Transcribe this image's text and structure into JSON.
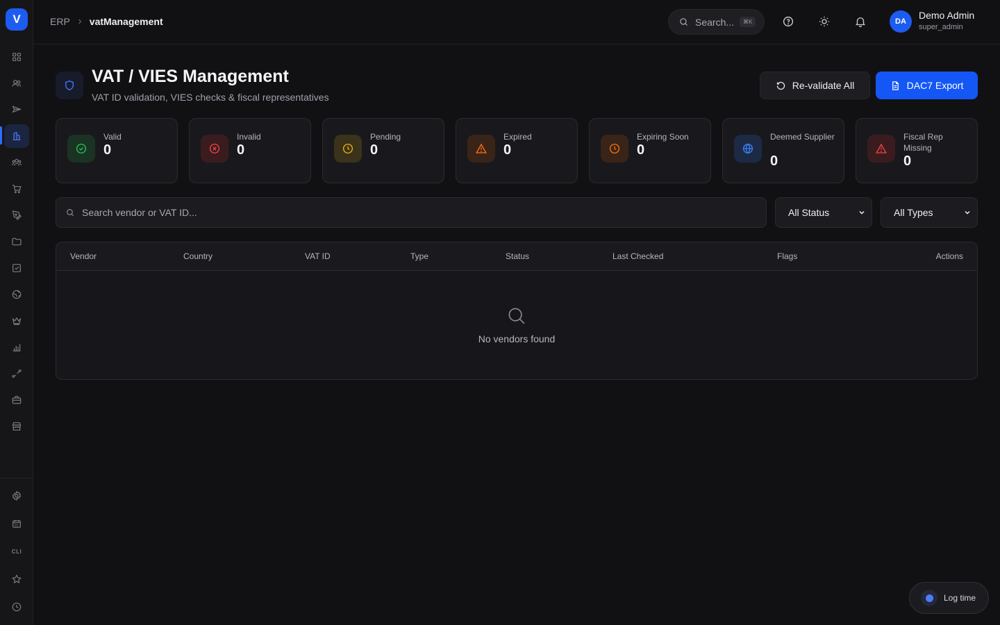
{
  "sidebar": {
    "logo": "V",
    "cli_label": "CLI",
    "items": [
      {
        "icon": "dashboard-grid-icon",
        "active": false
      },
      {
        "icon": "users-icon",
        "active": false
      },
      {
        "icon": "send-icon",
        "active": false
      },
      {
        "icon": "building-icon",
        "active": true
      },
      {
        "icon": "team-icon",
        "active": false
      },
      {
        "icon": "cart-icon",
        "active": false
      },
      {
        "icon": "pen-tool-icon",
        "active": false
      },
      {
        "icon": "folder-icon",
        "active": false
      },
      {
        "icon": "checkbox-icon",
        "active": false
      },
      {
        "icon": "globe-icon",
        "active": false
      },
      {
        "icon": "crown-icon",
        "active": false
      },
      {
        "icon": "bar-chart-icon",
        "active": false
      },
      {
        "icon": "route-icon",
        "active": false
      },
      {
        "icon": "briefcase-icon",
        "active": false
      },
      {
        "icon": "store-icon",
        "active": false
      }
    ],
    "bottom_items": [
      {
        "icon": "settings-gear-icon"
      },
      {
        "icon": "calendar-icon"
      },
      {
        "icon": "cli-icon"
      },
      {
        "icon": "star-icon"
      },
      {
        "icon": "clock-icon"
      }
    ]
  },
  "topbar": {
    "breadcrumb": {
      "root": "ERP",
      "current": "vatManagement"
    },
    "search": {
      "placeholder": "Search...",
      "shortcut": "⌘K"
    },
    "user": {
      "initials": "DA",
      "name": "Demo Admin",
      "role": "super_admin"
    }
  },
  "header": {
    "title": "VAT / VIES Management",
    "subtitle": "VAT ID validation, VIES checks & fiscal representatives",
    "revalidate_label": "Re-validate All",
    "export_label": "DAC7 Export"
  },
  "stats": [
    {
      "label": "Valid",
      "value": "0",
      "color": "#22c55e",
      "icon": "check-circle-icon"
    },
    {
      "label": "Invalid",
      "value": "0",
      "color": "#ef4444",
      "icon": "x-circle-icon"
    },
    {
      "label": "Pending",
      "value": "0",
      "color": "#eab308",
      "icon": "clock-icon"
    },
    {
      "label": "Expired",
      "value": "0",
      "color": "#f97316",
      "icon": "alert-triangle-icon"
    },
    {
      "label": "Expiring Soon",
      "value": "0",
      "color": "#f97316",
      "icon": "clock-icon"
    },
    {
      "label": "Deemed Supplier",
      "value": "0",
      "color": "#3b82f6",
      "icon": "globe-icon"
    },
    {
      "label": "Fiscal Rep Missing",
      "value": "0",
      "color": "#ef4444",
      "icon": "alert-triangle-icon"
    }
  ],
  "filters": {
    "search_placeholder": "Search vendor or VAT ID...",
    "status_selected": "All Status",
    "type_selected": "All Types"
  },
  "table": {
    "columns": [
      "Vendor",
      "Country",
      "VAT ID",
      "Type",
      "Status",
      "Last Checked",
      "Flags",
      "Actions"
    ],
    "rows": [],
    "empty_text": "No vendors found"
  },
  "log_time": {
    "label": "Log time"
  },
  "colors": {
    "accent": "#1457f5",
    "background": "#111114",
    "card": "#19191d"
  }
}
